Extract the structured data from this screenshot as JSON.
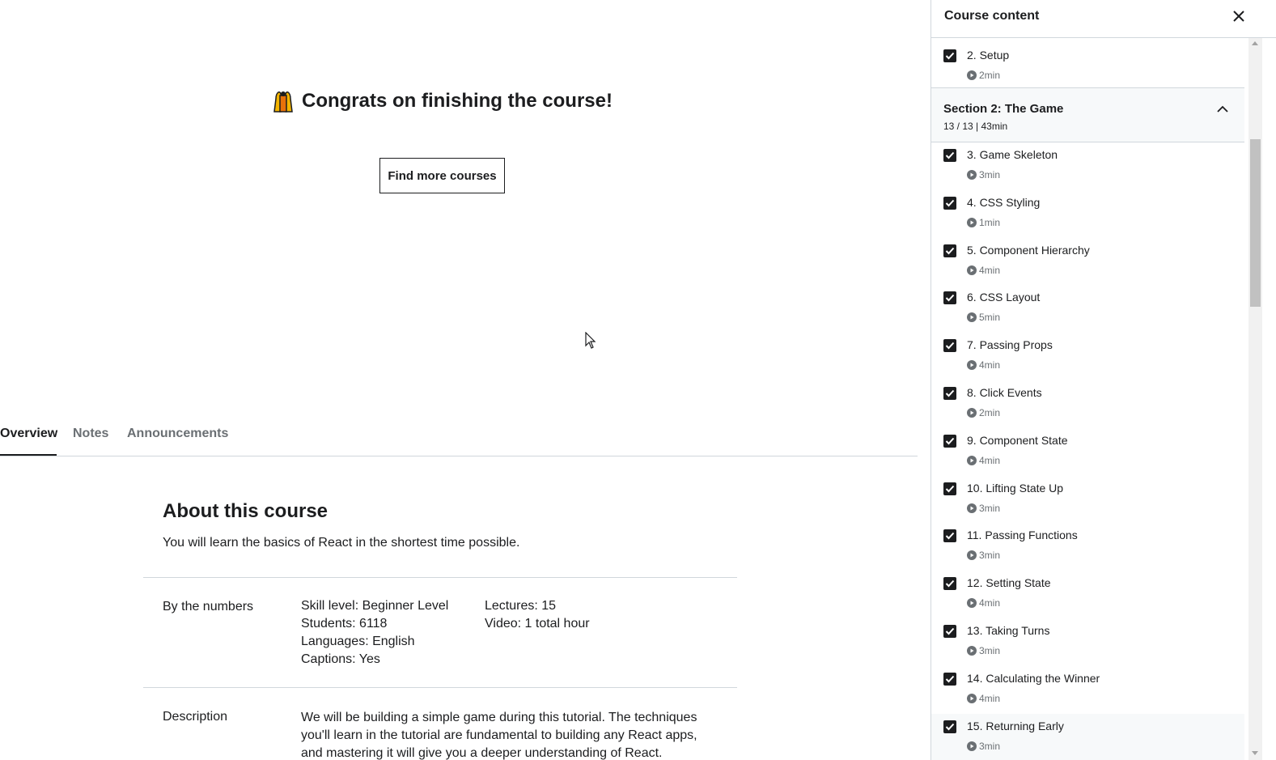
{
  "hero": {
    "congrats": "Congrats on finishing the course!",
    "find_more_label": "Find more courses"
  },
  "tabs": [
    {
      "label": "Overview",
      "active": true
    },
    {
      "label": "Notes",
      "active": false
    },
    {
      "label": "Announcements",
      "active": false
    }
  ],
  "about": {
    "title": "About this course",
    "subtitle": "You will learn the basics of React in the shortest time possible.",
    "by_numbers_label": "By the numbers",
    "stats_col1": [
      "Skill level: Beginner Level",
      "Students: 6118",
      "Languages: English",
      "Captions: Yes"
    ],
    "stats_col2": [
      "Lectures: 15",
      "Video: 1 total hour"
    ],
    "description_label": "Description",
    "description": "We will be building a simple game during this tutorial. The techniques you'll learn in the tutorial are fundamental to building any React apps, and mastering it will give you a deeper understanding of React."
  },
  "sidebar": {
    "title": "Course content",
    "close_icon": "close-icon",
    "first_lecture": {
      "title": "2. Setup",
      "duration": "2min",
      "completed": true
    },
    "section": {
      "title": "Section 2: The Game",
      "meta": "13 / 13 | 43min",
      "expanded": true
    },
    "lectures": [
      {
        "title": "3. Game Skeleton",
        "duration": "3min",
        "completed": true
      },
      {
        "title": "4. CSS Styling",
        "duration": "1min",
        "completed": true
      },
      {
        "title": "5. Component Hierarchy",
        "duration": "4min",
        "completed": true
      },
      {
        "title": "6. CSS Layout",
        "duration": "5min",
        "completed": true
      },
      {
        "title": "7. Passing Props",
        "duration": "4min",
        "completed": true
      },
      {
        "title": "8. Click Events",
        "duration": "2min",
        "completed": true
      },
      {
        "title": "9. Component State",
        "duration": "4min",
        "completed": true
      },
      {
        "title": "10. Lifting State Up",
        "duration": "3min",
        "completed": true
      },
      {
        "title": "11. Passing Functions",
        "duration": "3min",
        "completed": true
      },
      {
        "title": "12. Setting State",
        "duration": "4min",
        "completed": true
      },
      {
        "title": "13. Taking Turns",
        "duration": "3min",
        "completed": true
      },
      {
        "title": "14. Calculating the Winner",
        "duration": "4min",
        "completed": true
      },
      {
        "title": "15. Returning Early",
        "duration": "3min",
        "completed": true,
        "current": true
      }
    ]
  }
}
